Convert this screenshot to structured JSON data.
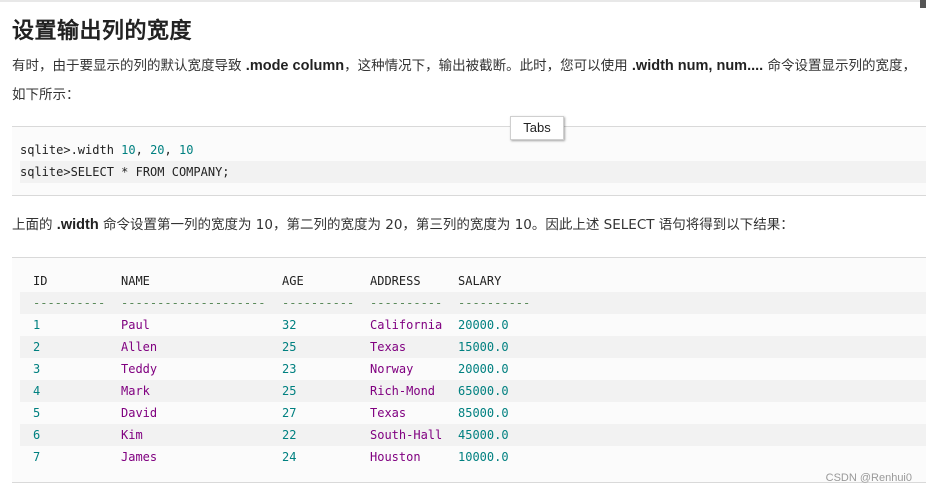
{
  "title": "设置输出列的宽度",
  "para1": {
    "before": "有时，由于要显示的列的默认宽度导致 ",
    "bold1": ".mode column",
    "middle": "，这种情况下，输出被截断。此时，您可以使用 ",
    "bold2": ".width num, num....",
    "after": " 命令设置显示列的宽度，如下所示："
  },
  "tabs_button": "Tabs",
  "code1": {
    "line1_cmd": "sqlite>.width ",
    "line1_nums": [
      "10",
      "20",
      "10"
    ],
    "line2": "sqlite>SELECT * FROM COMPANY;"
  },
  "para2": {
    "before": "上面的 ",
    "bold": ".width",
    "after": " 命令设置第一列的宽度为 10，第二列的宽度为 20，第三列的宽度为 10。因此上述 SELECT 语句将得到以下结果："
  },
  "result": {
    "headers": [
      "ID",
      "NAME",
      "AGE",
      "ADDRESS",
      "SALARY"
    ],
    "dashes": [
      "----------",
      "--------------------",
      "----------",
      "----------",
      "----------"
    ],
    "rows": [
      [
        "1",
        "Paul",
        "32",
        "California",
        "20000.0"
      ],
      [
        "2",
        "Allen",
        "25",
        "Texas",
        "15000.0"
      ],
      [
        "3",
        "Teddy",
        "23",
        "Norway",
        "20000.0"
      ],
      [
        "4",
        "Mark",
        "25",
        "Rich-Mond",
        "65000.0"
      ],
      [
        "5",
        "David",
        "27",
        "Texas",
        "85000.0"
      ],
      [
        "6",
        "Kim",
        "22",
        "South-Hall",
        "45000.0"
      ],
      [
        "7",
        "James",
        "24",
        "Houston",
        "10000.0"
      ]
    ]
  },
  "watermark": "CSDN @Renhui0"
}
